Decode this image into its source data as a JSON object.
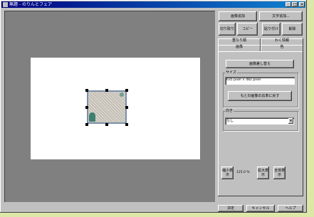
{
  "window": {
    "title": "無題 - のりんとフェア"
  },
  "toolbar": {
    "add_image": "画像追加",
    "add_text": "文字追加...",
    "cut": "切り取り",
    "copy": "コピー",
    "paste": "貼り付け",
    "delete": "削除"
  },
  "tabs": {
    "layer_order": "重なり順",
    "image": "画像",
    "frame_info": "わく情報",
    "color": "色"
  },
  "image_panel": {
    "replace_image": "画像差し替え",
    "size_label": "サイズ",
    "size_value": "635 pixel × 482 pixel",
    "restore_ratio": "もとの画像の比率に戻す",
    "orientation_label": "向き",
    "orientation_value": "なし"
  },
  "zoom": {
    "out_label": "縮小表示",
    "value": "125.0 %",
    "in_label": "拡大表示",
    "fit_label": "全体表示"
  },
  "footer": {
    "ok": "決定",
    "cancel": "キャンセル",
    "help": "ヘルプ"
  },
  "icons": {
    "app": "app-icon",
    "minimize": "minimize-icon",
    "maximize": "maximize-icon",
    "close": "close-icon",
    "dropdown": "chevron-down-icon"
  }
}
